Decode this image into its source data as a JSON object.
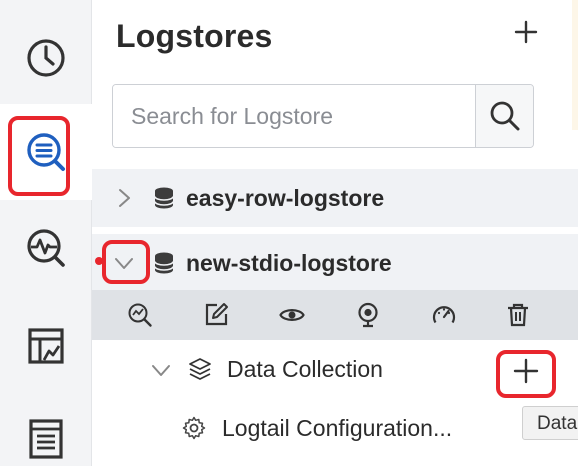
{
  "rail": {
    "items": [
      {
        "name": "history",
        "icon": "clock-icon"
      },
      {
        "name": "query-analysis",
        "icon": "search-list-icon",
        "active": true
      },
      {
        "name": "metrics-search",
        "icon": "pulse-search-icon"
      },
      {
        "name": "dashboard",
        "icon": "dashboard-chart-icon"
      },
      {
        "name": "logs",
        "icon": "document-list-icon"
      }
    ]
  },
  "panel": {
    "title": "Logstores",
    "add_icon": "plus-icon",
    "search": {
      "placeholder": "Search for Logstore",
      "value": "",
      "button_icon": "magnifier-icon"
    }
  },
  "logstores": [
    {
      "name": "easy-row-logstore",
      "expanded": false,
      "icon": "database-icon"
    },
    {
      "name": "new-stdio-logstore",
      "expanded": true,
      "icon": "database-icon"
    }
  ],
  "toolbar": {
    "icons": [
      "search-chart-icon",
      "edit-icon",
      "eye-icon",
      "webcam-icon",
      "gauge-icon",
      "trash-icon"
    ]
  },
  "tree": {
    "data_collection": {
      "label": "Data Collection",
      "icon": "layers-icon",
      "add_icon": "plus-icon"
    },
    "logtail": {
      "label": "Logtail Configuration...",
      "icon": "gear-icon"
    }
  },
  "tooltip": {
    "text": "Data"
  },
  "colors": {
    "highlight": "#e8262d",
    "accent": "#1f5fbf",
    "icon": "#333333",
    "rail_bg": "#f3f4f6",
    "row_bg": "#f0f2f5",
    "toolbar_bg": "#dfe2e6"
  }
}
